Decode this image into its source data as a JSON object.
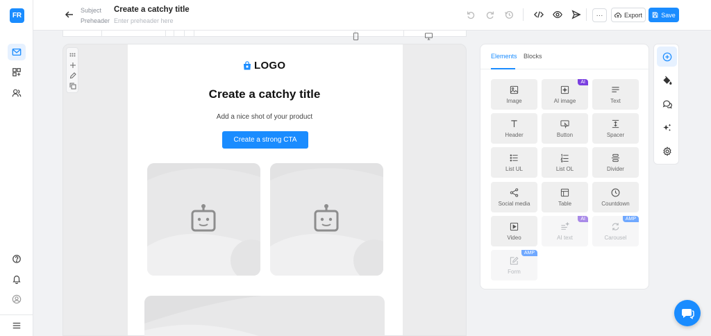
{
  "app": {
    "avatar_initials": "FR"
  },
  "header": {
    "subject_label": "Subject",
    "subject_value": "Create a catchy title",
    "preheader_label": "Preheader",
    "preheader_placeholder": "Enter preheader here",
    "more_label": "···",
    "export_label": "Export",
    "save_label": "Save"
  },
  "email": {
    "logo_text": "LOGO",
    "title": "Create a catchy title",
    "subtitle": "Add a nice shot of your product",
    "cta_label": "Create a strong CTA"
  },
  "panel": {
    "tabs": [
      {
        "label": "Elements"
      },
      {
        "label": "Blocks"
      }
    ],
    "tiles": [
      {
        "label": "Image",
        "icon": "image-icon"
      },
      {
        "label": "AI image",
        "icon": "ai-image-icon",
        "badge": "AI"
      },
      {
        "label": "Text",
        "icon": "text-icon"
      },
      {
        "label": "Header",
        "icon": "header-icon"
      },
      {
        "label": "Button",
        "icon": "button-icon"
      },
      {
        "label": "Spacer",
        "icon": "spacer-icon"
      },
      {
        "label": "List UL",
        "icon": "list-ul-icon"
      },
      {
        "label": "List OL",
        "icon": "list-ol-icon"
      },
      {
        "label": "Divider",
        "icon": "divider-icon"
      },
      {
        "label": "Social media",
        "icon": "share-icon"
      },
      {
        "label": "Table",
        "icon": "table-icon"
      },
      {
        "label": "Countdown",
        "icon": "clock-icon"
      },
      {
        "label": "Video",
        "icon": "video-icon"
      },
      {
        "label": "AI text",
        "icon": "ai-text-icon",
        "badge": "AI"
      },
      {
        "label": "Carousel",
        "icon": "carousel-icon",
        "badge": "AMP"
      },
      {
        "label": "Form",
        "icon": "form-icon",
        "badge": "AMP"
      }
    ]
  },
  "colors": {
    "accent": "#1a8cff",
    "ai_badge": "#7a3fe0",
    "amp_badge": "#6fa8ff"
  }
}
